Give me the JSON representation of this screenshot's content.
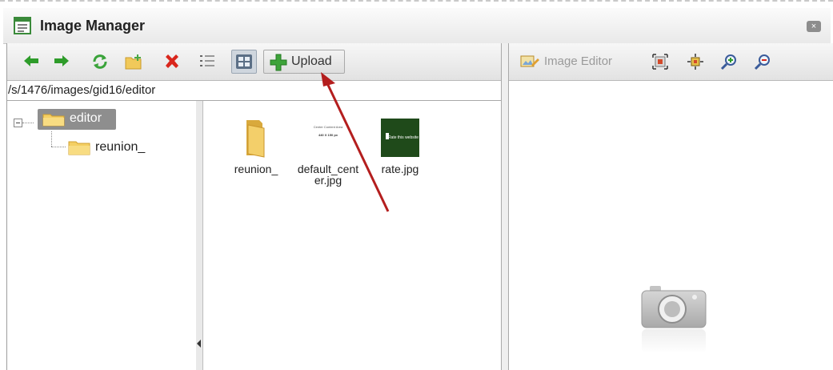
{
  "window": {
    "title": "Image Manager",
    "close_label": "×"
  },
  "toolbar": {
    "upload_label": "Upload"
  },
  "path": "/s/1476/images/gid16/editor",
  "tree": {
    "root": {
      "label": "editor",
      "selected": true
    },
    "children": [
      {
        "label": "reunion_"
      }
    ]
  },
  "files": [
    {
      "name_line1": "reunion_",
      "name_line2": "",
      "type": "folder-icon"
    },
    {
      "name_line1": "default_cent",
      "name_line2": "er.jpg",
      "type": "image-thumbnail"
    },
    {
      "name_line1": "rate.jpg",
      "name_line2": "",
      "type": "image-thumbnail"
    }
  ],
  "default_center_thumb": {
    "line1": "Center Content Area",
    "line2": "440 X 150 px"
  },
  "rate_thumb": {
    "text": "Rate this website"
  },
  "editor": {
    "label": "Image Editor"
  },
  "colors": {
    "arrow_green": "#2e9c2a",
    "delete_red": "#d9261c",
    "annotation_arrow": "#b41e1e",
    "selected_node_bg": "#8e8e8e",
    "rate_thumb_bg": "#1f4a1a"
  }
}
